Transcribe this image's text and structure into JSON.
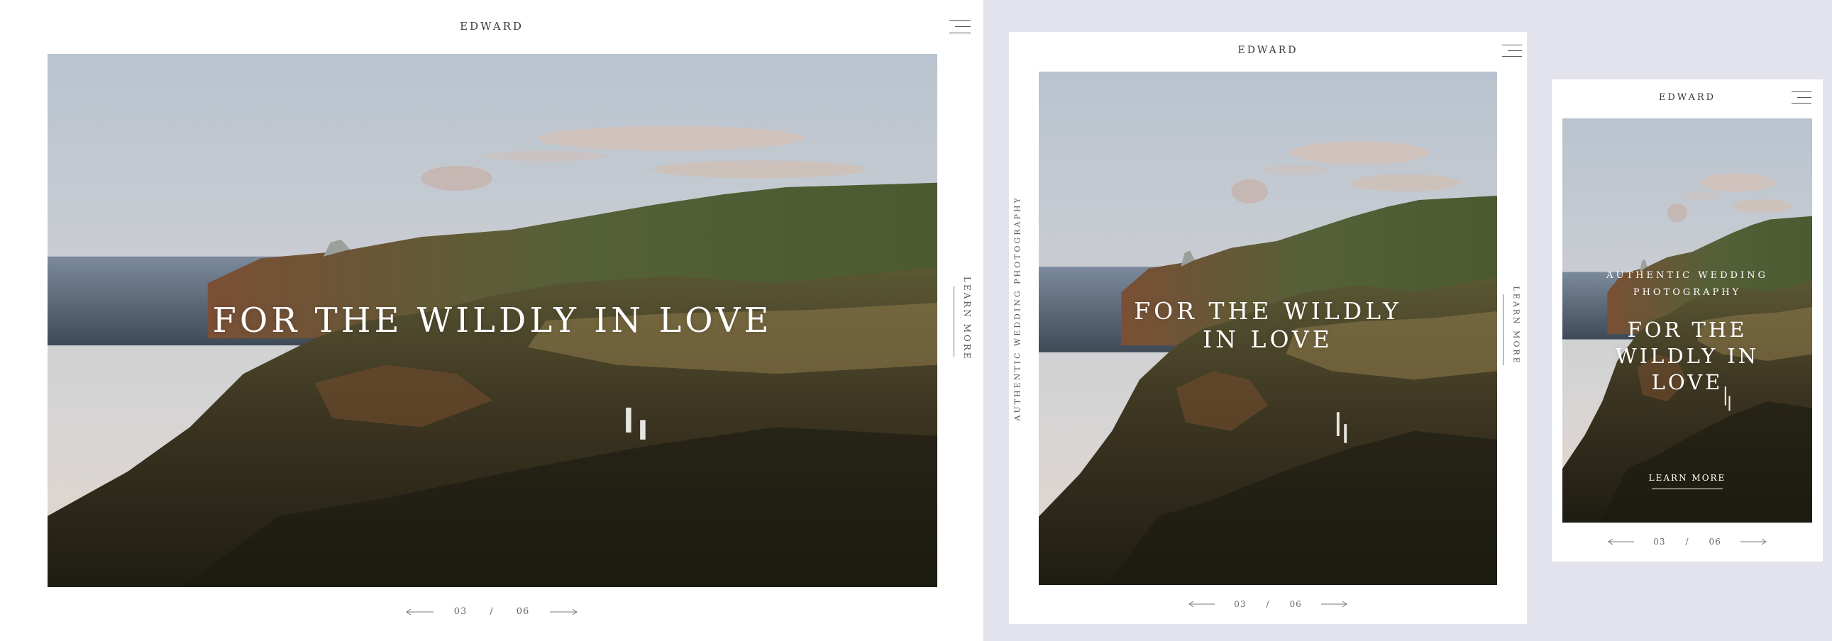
{
  "brand": "EDWARD",
  "headline": "FOR THE WILDLY IN LOVE",
  "tagline": "AUTHENTIC WEDDING PHOTOGRAPHY",
  "learn_more": "LEARN MORE",
  "pager": {
    "current": "03",
    "separator": "/",
    "total": "06"
  },
  "icons": {
    "menu": "hamburger-icon",
    "prev": "arrow-left-icon",
    "next": "arrow-right-icon"
  },
  "colors": {
    "backdrop": "#e3e3ee",
    "frame": "#ffffff",
    "text": "#3a3a3a"
  }
}
